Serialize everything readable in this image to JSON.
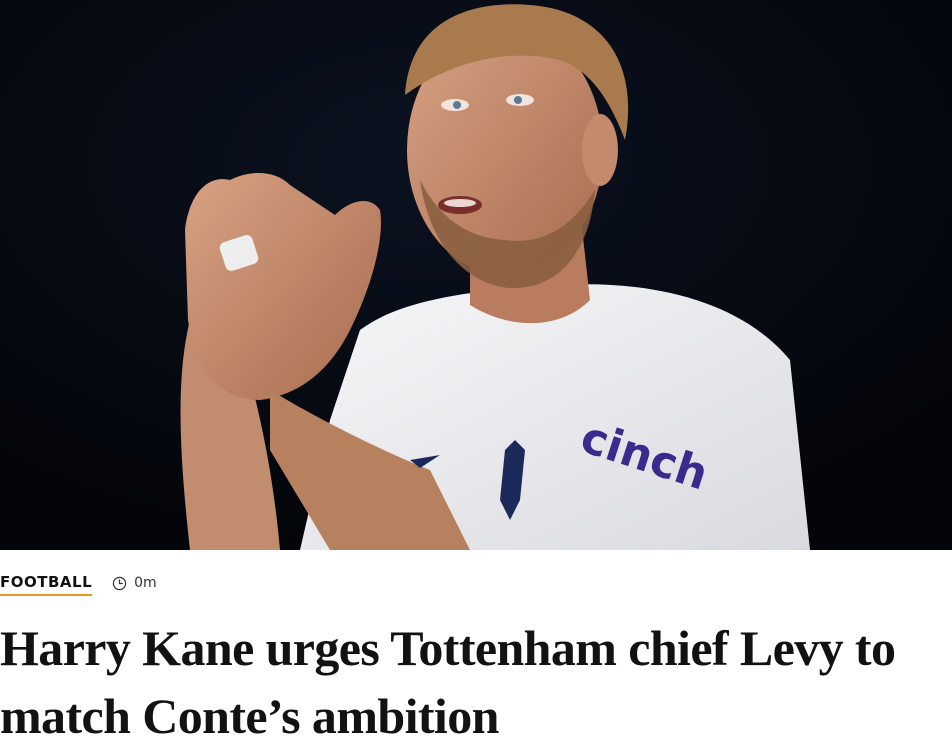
{
  "article": {
    "hero_image": {
      "subject": "footballer-applauding",
      "shirt_sponsor": "cinch"
    },
    "category": "FOOTBALL",
    "time_ago": "0m",
    "headline": "Harry Kane urges Tottenham chief Levy to match Conte’s ambition"
  },
  "colors": {
    "accent": "#e8961e",
    "text": "#121212",
    "hero_background": "#05070d"
  },
  "icons": {
    "time": "clock-icon"
  }
}
